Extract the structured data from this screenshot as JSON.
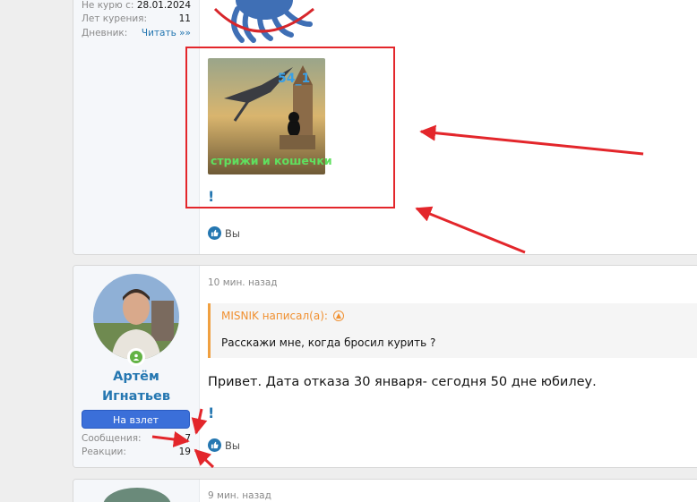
{
  "post1": {
    "stats": [
      {
        "label": "Не курю с:",
        "value": "28.01.2024"
      },
      {
        "label": "Лет курения:",
        "value": "11"
      },
      {
        "label": "Дневник:",
        "value": "Читать »»"
      }
    ],
    "attachment": {
      "text_top": "54_1",
      "text_bottom": "стрижи и кошечки"
    },
    "exclamation": "!",
    "reaction_text": "Вы"
  },
  "post2": {
    "username_line1": "Артём",
    "username_line2": "Игнатьев",
    "rank": "На взлет",
    "stats": [
      {
        "label": "Сообщения:",
        "value": "7"
      },
      {
        "label": "Реакции:",
        "value": "19"
      }
    ],
    "time": "10 мин. назад",
    "quote": {
      "author": "MISNIK написал(а):",
      "body": "Расскажи мне, когда бросил курить ?"
    },
    "message": "Привет. Дата отказа 30 января- сегодня 50 дне юбилеу.",
    "exclamation": "!",
    "reaction_text": "Вы"
  },
  "post3": {
    "time": "9 мин. назад"
  },
  "colors": {
    "link": "#2577b1",
    "badge": "#3b6fd9",
    "annotation": "#e3262b",
    "quote_accent": "#f09030"
  }
}
